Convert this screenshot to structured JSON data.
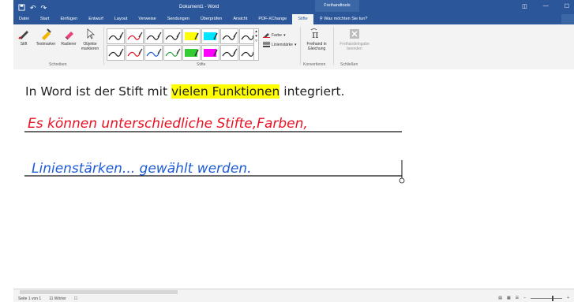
{
  "window": {
    "quick_access": {
      "save_icon": "save-icon",
      "undo": "↶",
      "redo": "↷"
    },
    "title": "Dokument1 - Word",
    "context_tab_group": "Freihandtools",
    "controls": [
      "◫",
      "—",
      "☐"
    ]
  },
  "tabs": [
    "Datei",
    "Start",
    "Einfügen",
    "Entwurf",
    "Layout",
    "Verweise",
    "Sendungen",
    "Überprüfen",
    "Ansicht",
    "PDF-XChange",
    "Stifte"
  ],
  "active_tab": "Stifte",
  "tell_me": "Was möchten Sie tun?",
  "ribbon": {
    "write_group": {
      "label": "Schreiben",
      "pen": "Stift",
      "highlighter": "Textmarker",
      "eraser": "Radierer",
      "select_line1": "Objekte",
      "select_line2": "markieren"
    },
    "pens_group": {
      "label": "Stifte",
      "color_label": "Farbe",
      "thickness_label": "Linienstärke",
      "pens": [
        {
          "color": "#222222"
        },
        {
          "color": "#e81123"
        },
        {
          "color": "#222222"
        },
        {
          "color": "#222222"
        },
        {
          "color": "#ffff00"
        },
        {
          "color": "#00e5ff"
        },
        {
          "color": "#222222"
        },
        {
          "color": "#222222"
        },
        {
          "color": "#222222"
        },
        {
          "color": "#e81123"
        },
        {
          "color": "#1e5bd6"
        },
        {
          "color": "#2ea043"
        },
        {
          "color": "#33cc33"
        },
        {
          "color": "#ff00ff"
        },
        {
          "color": "#222222"
        },
        {
          "color": "#222222"
        }
      ]
    },
    "convert_group": {
      "label": "Konvertieren",
      "ink_to_math_line1": "Freihand in",
      "ink_to_math_line2": "Gleichung"
    },
    "close_group": {
      "label": "Schließen",
      "close_ink_line1": "Freihandeingabe",
      "close_ink_line2": "beenden"
    }
  },
  "document": {
    "typed_line_before": "In Word ist der Stift mit ",
    "typed_line_highlight": "vielen Funktionen",
    "typed_line_after": " integriert.",
    "handwriting_line1": "Es können unterschiedliche Stifte,Farben,",
    "handwriting_line1_color": "#e81123",
    "handwriting_line2": "Linienstärken... gewählt werden.",
    "handwriting_line2_color": "#1e5bd6",
    "highlight_color": "#ffff00"
  },
  "status": {
    "page": "Seite 1 von 1",
    "words": "11 Wörter",
    "proof_icon": "proofing-icon"
  },
  "colors": {
    "titlebar": "#2b579a",
    "ribbon": "#f3f3f3"
  }
}
